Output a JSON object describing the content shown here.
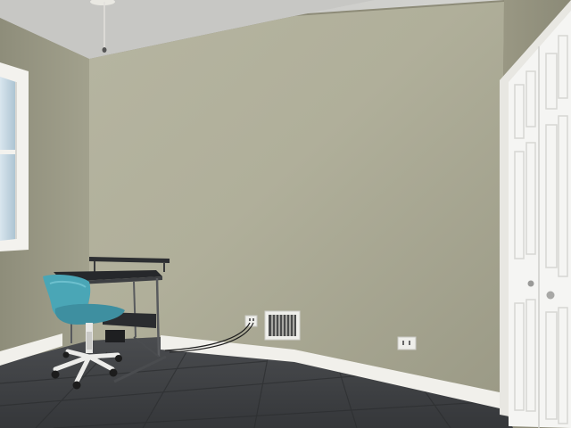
{
  "scene": {
    "description_colors": {
      "back_wall": "#a8a792",
      "left_wall": "#9a9985",
      "right_wall": "#9c9b86",
      "ceiling": "#c9c9c6",
      "floor": "#3f4245",
      "trim": "#f2f1ec",
      "door": "#f4f4f2",
      "chair": "#4aa3b3",
      "desk": "#2b2d30"
    },
    "objects": {
      "window": "window",
      "ceiling_fan_pull": "ceiling-fan-pull-cord",
      "desk": "computer-desk",
      "chair": "office-chair",
      "vent": "floor-register-vent",
      "outlet_left": "wall-outlet",
      "outlet_right": "wall-outlet",
      "closet": "bifold-closet-door"
    }
  }
}
